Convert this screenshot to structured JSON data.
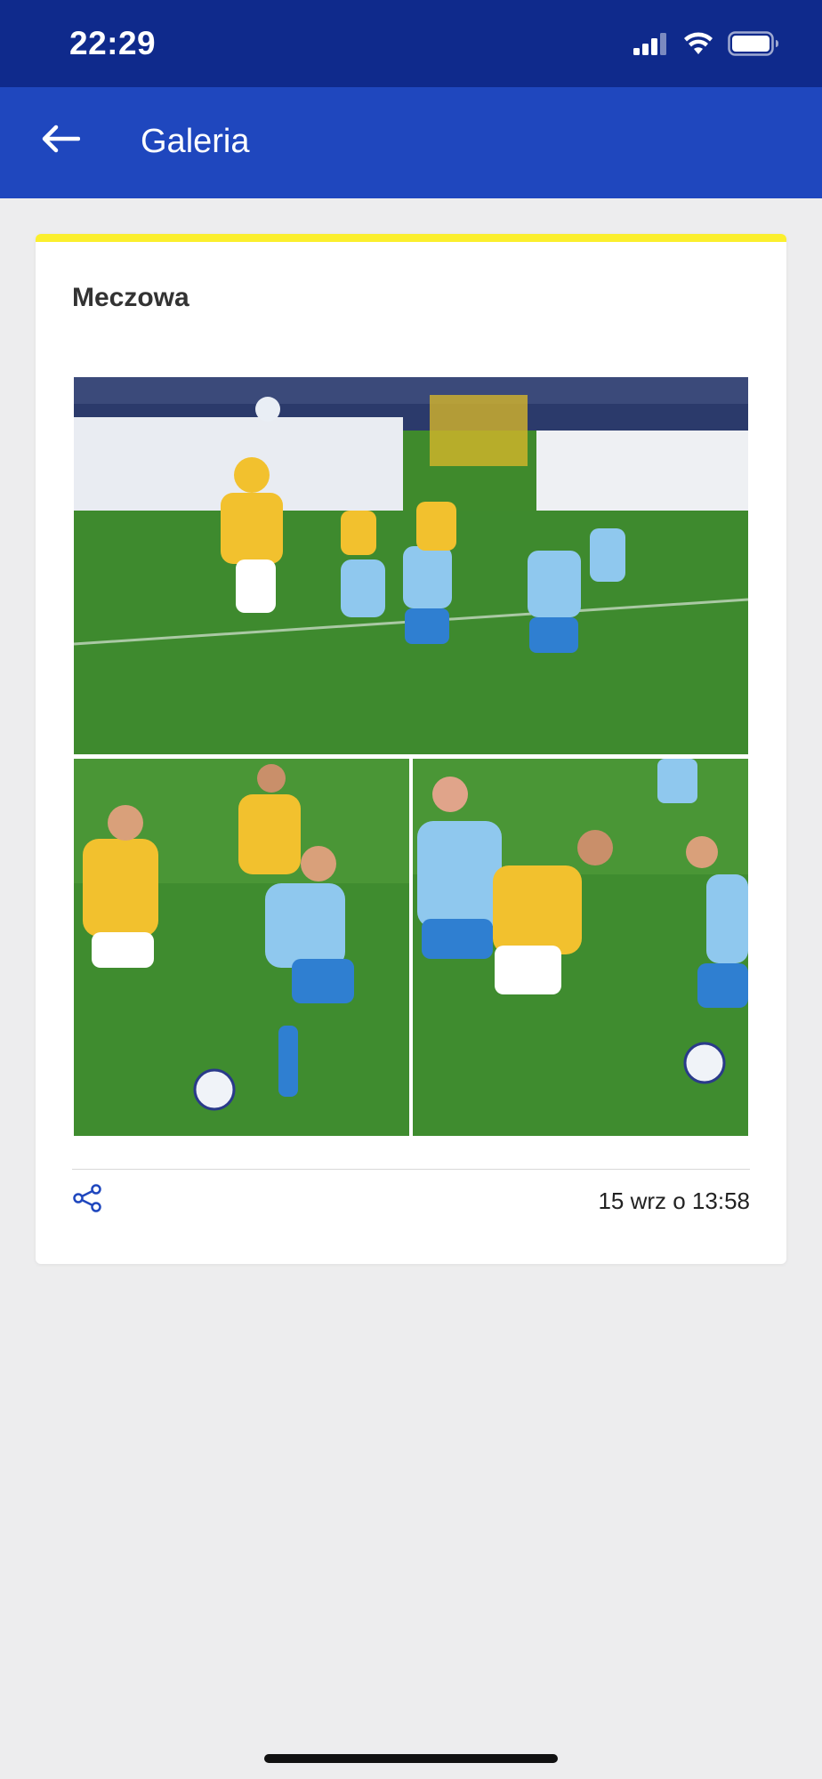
{
  "status_bar": {
    "time": "22:29",
    "icons": [
      "signal-icon",
      "wifi-icon",
      "battery-icon"
    ]
  },
  "app_bar": {
    "back_icon": "arrow-left-icon",
    "title": "Galeria"
  },
  "gallery_card": {
    "title": "Meczowa",
    "accent_color": "#fbef2d",
    "photos": [
      "match-photo-header",
      "match-photo-tackle",
      "match-photo-dribble"
    ],
    "share_icon": "share-icon",
    "timestamp": "15 wrz o 13:58"
  },
  "colors": {
    "status_bar": "#0f2a8c",
    "app_bar": "#1f47be",
    "background": "#ededee",
    "icon_blue": "#1f47be"
  }
}
